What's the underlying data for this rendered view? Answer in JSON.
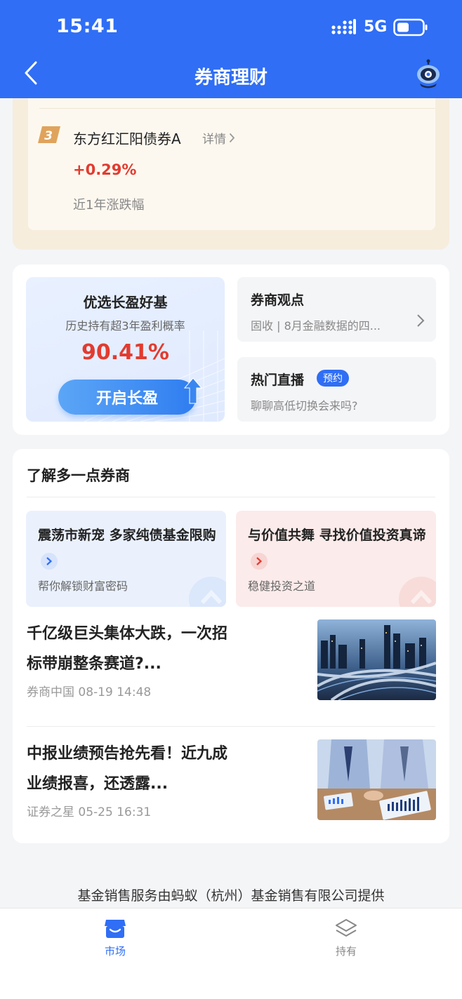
{
  "status_bar": {
    "time": "15:41",
    "network": "5G"
  },
  "header": {
    "title": "券商理财"
  },
  "rank_card": {
    "rank": "3",
    "fund_name": "东方红汇阳债券A",
    "detail_label": "详情",
    "return_value": "+0.29%",
    "return_label": "近1年涨跌幅"
  },
  "promo": {
    "title": "优选长盈好基",
    "subtitle": "历史持有超3年盈利概率",
    "rate": "90.41%",
    "button_label": "开启长盈"
  },
  "broker_view": {
    "title": "券商观点",
    "desc": "固收 | 8月金融数据的四..."
  },
  "live": {
    "title": "热门直播",
    "badge": "预约",
    "desc": "聊聊高低切换会来吗?"
  },
  "learn": {
    "title": "了解多一点券商",
    "topics": [
      {
        "title": "震荡市新宠 多家纯债基金限购",
        "desc": "帮你解锁财富密码"
      },
      {
        "title": "与价值共舞 寻找价值投资真谛",
        "desc": "稳健投资之道"
      }
    ],
    "news": [
      {
        "title": "千亿级巨头集体大跌，一次招标带崩整条赛道?...",
        "source": "券商中国",
        "time": "08-19 14:48"
      },
      {
        "title": "中报业绩预告抢先看！近九成业绩报喜，还透露...",
        "source": "证券之星",
        "time": "05-25 16:31"
      }
    ]
  },
  "disclaimer": "基金销售服务由蚂蚁（杭州）基金销售有限公司提供",
  "tabs": [
    {
      "label": "市场",
      "icon": "store-icon",
      "active": true
    },
    {
      "label": "持有",
      "icon": "layers-icon",
      "active": false
    }
  ],
  "colors": {
    "brand_blue": "#2f6ef5",
    "rise_red": "#e23b30",
    "rank_bg": "#f6eddd"
  }
}
